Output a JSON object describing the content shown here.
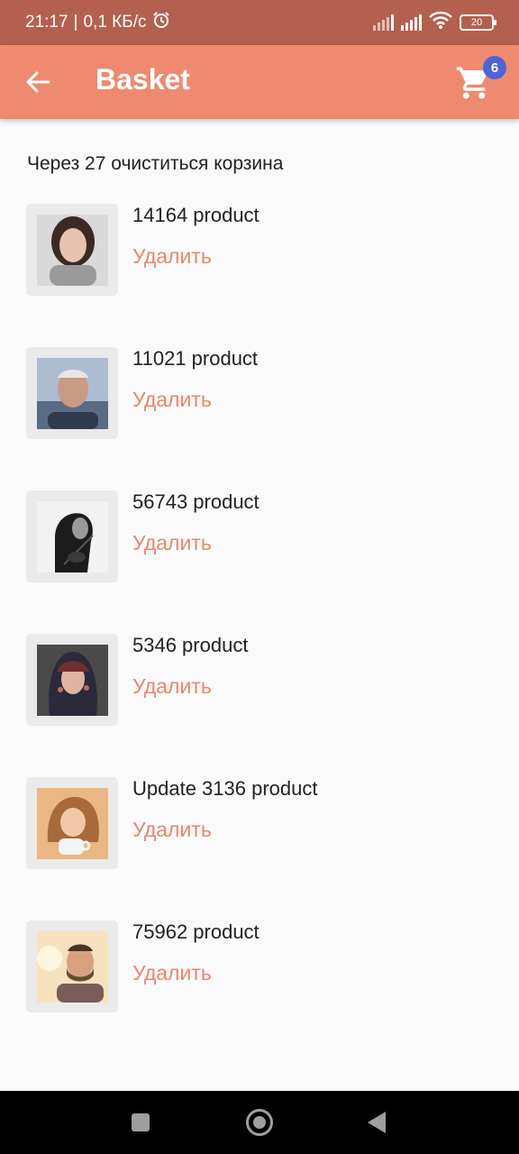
{
  "status_bar": {
    "time": "21:17",
    "separator": "|",
    "speed": "0,1 КБ/с",
    "battery": "20",
    "icons": [
      "alarm-icon",
      "signal-icon",
      "signal-icon",
      "wifi-icon",
      "battery-icon"
    ]
  },
  "app_bar": {
    "title": "Basket",
    "back_icon": "arrow-left-icon",
    "cart_icon": "cart-icon",
    "cart_count": "6",
    "background": "#ee8a6f",
    "badge_color": "#4f63d9"
  },
  "notice": "Через 27 очиститься корзина",
  "items": [
    {
      "name": "14164 product",
      "delete_label": "Удалить"
    },
    {
      "name": "11021 product",
      "delete_label": "Удалить"
    },
    {
      "name": "56743 product",
      "delete_label": "Удалить"
    },
    {
      "name": "5346 product",
      "delete_label": "Удалить"
    },
    {
      "name": "Update 3136 product",
      "delete_label": "Удалить"
    },
    {
      "name": "75962 product",
      "delete_label": "Удалить"
    }
  ],
  "colors": {
    "accent": "#e8876d",
    "status_bar": "#b4604e"
  },
  "nav_bar": {
    "icons": [
      "recents-icon",
      "home-icon",
      "back-icon"
    ]
  }
}
